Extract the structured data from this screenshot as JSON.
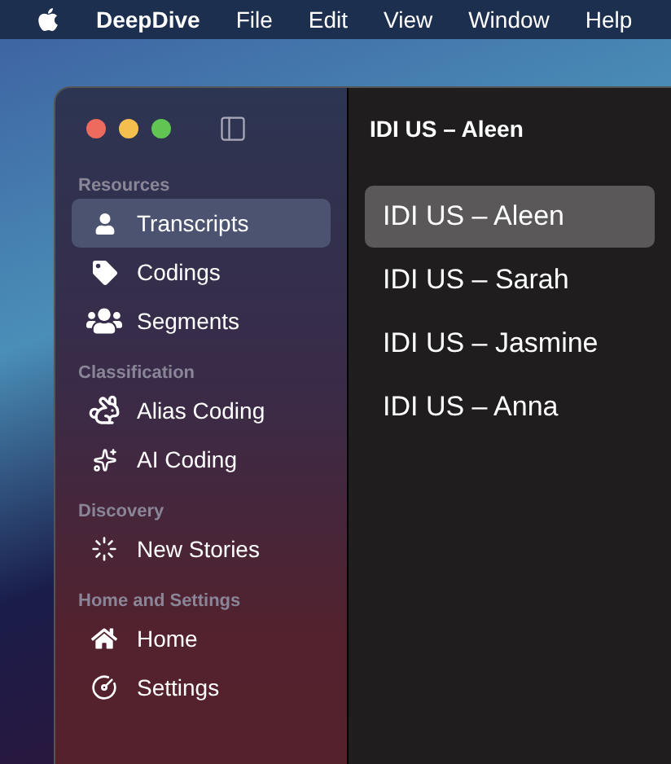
{
  "menu_bar": {
    "app_name": "DeepDive",
    "items": [
      "File",
      "Edit",
      "View",
      "Window",
      "Help"
    ]
  },
  "sidebar": {
    "sections": [
      {
        "header": "Resources",
        "items": [
          {
            "label": "Transcripts",
            "selected": true
          },
          {
            "label": "Codings",
            "selected": false
          },
          {
            "label": "Segments",
            "selected": false
          }
        ]
      },
      {
        "header": "Classification",
        "items": [
          {
            "label": "Alias Coding",
            "selected": false
          },
          {
            "label": "AI Coding",
            "selected": false
          }
        ]
      },
      {
        "header": "Discovery",
        "items": [
          {
            "label": "New Stories",
            "selected": false
          }
        ]
      },
      {
        "header": "Home and Settings",
        "items": [
          {
            "label": "Home",
            "selected": false
          },
          {
            "label": "Settings",
            "selected": false
          }
        ]
      }
    ]
  },
  "content": {
    "title": "IDI US – Aleen",
    "list": [
      {
        "label": "IDI US – Aleen",
        "selected": true
      },
      {
        "label": "IDI US – Sarah",
        "selected": false
      },
      {
        "label": "IDI US – Jasmine",
        "selected": false
      },
      {
        "label": "IDI US – Anna",
        "selected": false
      }
    ]
  }
}
